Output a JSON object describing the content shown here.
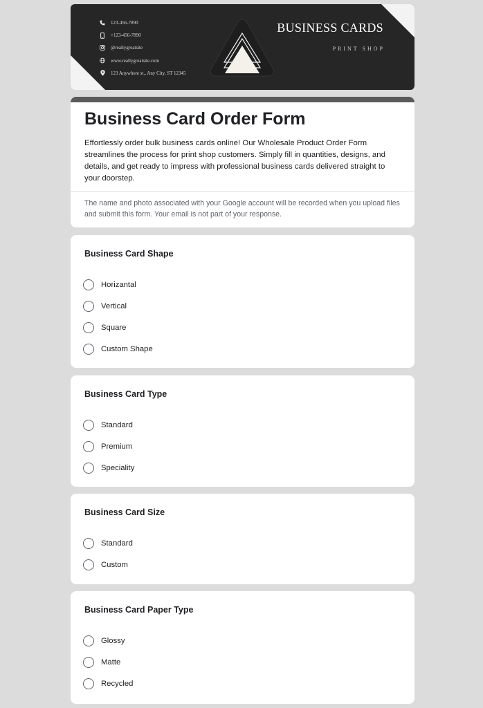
{
  "banner": {
    "contacts": [
      {
        "icon": "phone-icon",
        "text": "123-456-7890"
      },
      {
        "icon": "mobile-icon",
        "text": "+123-456-7890"
      },
      {
        "icon": "instagram-icon",
        "text": "@reallygreatsite"
      },
      {
        "icon": "globe-icon",
        "text": "www.reallygreatsite.com"
      },
      {
        "icon": "location-pin-icon",
        "text": "123 Anywhere st., Any City, ST 12345"
      }
    ],
    "title": "BUSINESS CARDS",
    "subtitle": "PRINT SHOP"
  },
  "form": {
    "title": "Business Card Order Form",
    "description": "Effortlessly order bulk business cards online! Our Wholesale Product Order Form streamlines the process for print shop customers. Simply fill in quantities, designs, and details, and get ready to impress with professional business cards delivered straight to your doorstep.",
    "notice": "The name and photo associated with your Google account will be recorded when you upload files and submit this form. Your email is not part of your response."
  },
  "questions": [
    {
      "title": "Business Card Shape",
      "options": [
        "Horizantal",
        "Vertical",
        "Square",
        "Custom Shape"
      ]
    },
    {
      "title": "Business Card Type",
      "options": [
        "Standard",
        "Premium",
        "Speciality"
      ]
    },
    {
      "title": "Business Card Size",
      "options": [
        "Standard",
        "Custom"
      ]
    },
    {
      "title": "Business Card Paper Type",
      "options": [
        "Glossy",
        "Matte",
        "Recycled"
      ]
    }
  ],
  "colors": {
    "background": "#dcdcdc",
    "banner": "#262626",
    "accent_bar": "#5a5a5a",
    "text": "#202124",
    "muted_text": "#5f6368"
  }
}
